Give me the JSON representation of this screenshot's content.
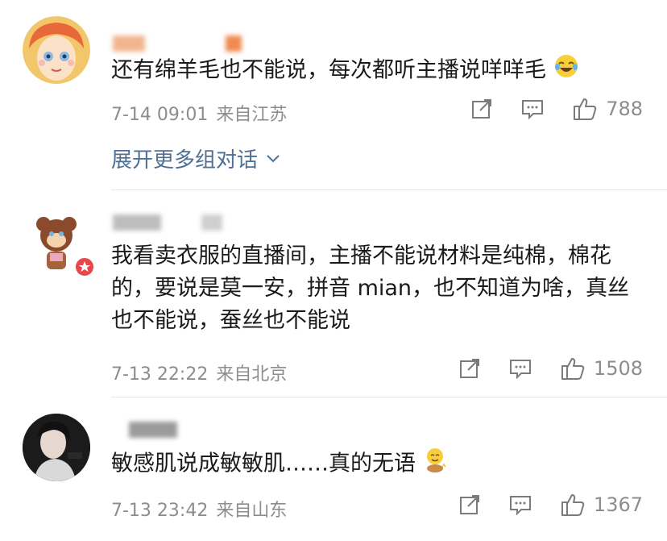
{
  "comments": [
    {
      "text": "还有绵羊毛也不能说，每次都听主播说咩咩毛",
      "time": "7-14 09:01",
      "location": "来自江苏",
      "likes": "788",
      "avatar_colors": [
        "#f6d6b9",
        "#e86c2b"
      ],
      "expand_label": "展开更多组对话"
    },
    {
      "text": "我看卖衣服的直播间，主播不能说材料是纯棉，棉花的，要说是莫一安，拼音 mian，也不知道为啥，真丝也不能说，蚕丝也不能说",
      "time": "7-13 22:22",
      "location": "来自北京",
      "likes": "1508"
    },
    {
      "text": "敏感肌说成敏敏肌……真的无语",
      "time": "7-13 23:42",
      "location": "来自山东",
      "likes": "1367"
    }
  ],
  "colors": {
    "meta": "#8d8d8d",
    "link": "#4f6f95",
    "badge": "#e8474b"
  }
}
